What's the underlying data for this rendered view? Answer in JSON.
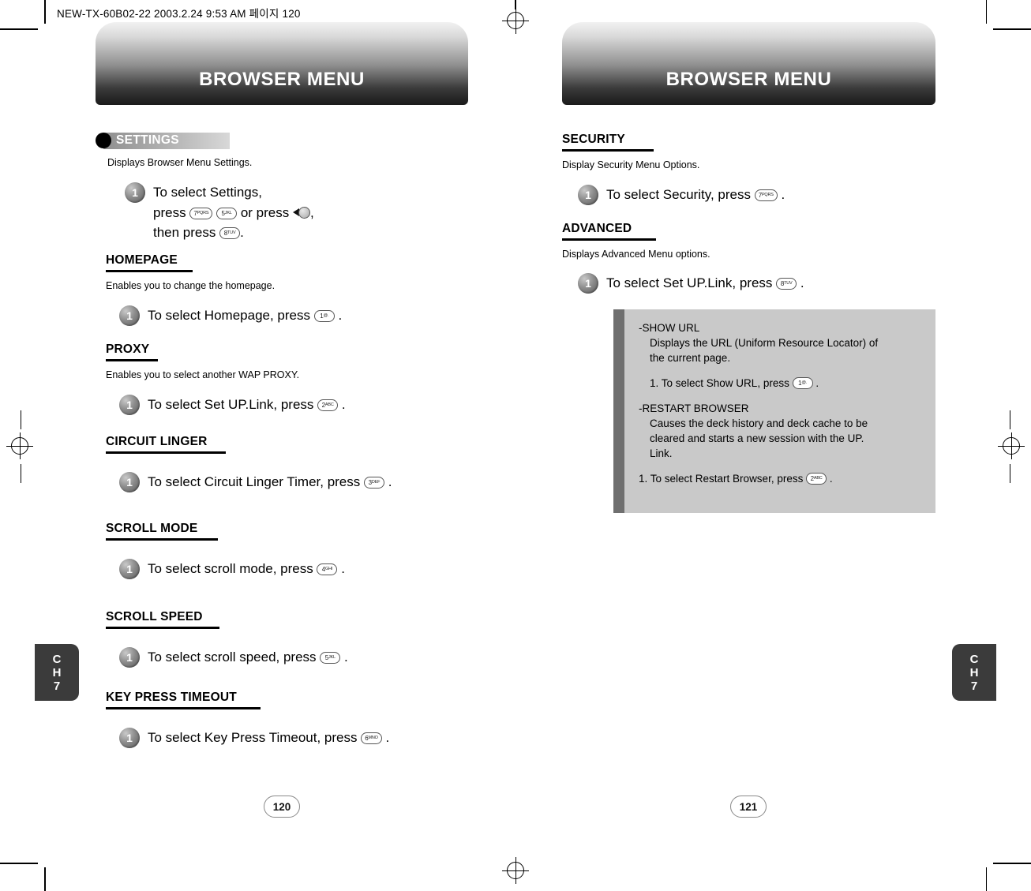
{
  "print_header": "NEW-TX-60B02-22  2003.2.24 9:53 AM  페이지 120",
  "left_page": {
    "title": "BROWSER MENU",
    "settings_pill": "SETTINGS",
    "settings_desc": "Displays Browser Menu Settings.",
    "settings_step": {
      "num": "1",
      "line1": "To select Settings,",
      "line2_pre": "press",
      "line2_key1": "7",
      "line2_key1_sup": "PQRS",
      "line2_key2": "5",
      "line2_key2_sup": "JKL",
      "line2_mid": "or press",
      "line2_post": ",",
      "line3_pre": "then press",
      "line3_key": "8",
      "line3_key_sup": "TUV",
      "line3_post": "."
    },
    "sections": [
      {
        "head": "HOMEPAGE",
        "desc": "Enables you to change the homepage.",
        "step_num": "1",
        "step_pre": "To select Homepage, press",
        "key": "1",
        "key_sup": "@.",
        "step_post": "."
      },
      {
        "head": "PROXY",
        "desc": "Enables you to select another WAP PROXY.",
        "step_num": "1",
        "step_pre": "To select Set UP.Link, press",
        "key": "2",
        "key_sup": "ABC",
        "step_post": "."
      },
      {
        "head": "CIRCUIT LINGER",
        "desc": "",
        "step_num": "1",
        "step_pre": "To select Circuit Linger Timer, press",
        "key": "3",
        "key_sup": "DEF",
        "step_post": "."
      },
      {
        "head": "SCROLL MODE",
        "desc": "",
        "step_num": "1",
        "step_pre": "To select scroll mode, press",
        "key": "4",
        "key_sup": "GHI",
        "step_post": "."
      },
      {
        "head": "SCROLL SPEED",
        "desc": "",
        "step_num": "1",
        "step_pre": "To select scroll speed, press",
        "key": "5",
        "key_sup": "JKL",
        "step_post": "."
      },
      {
        "head": "KEY PRESS TIMEOUT",
        "desc": "",
        "step_num": "1",
        "step_pre": "To select Key Press Timeout, press",
        "key": "6",
        "key_sup": "MNO",
        "step_post": "."
      }
    ],
    "chapter": {
      "line1": "C",
      "line2": "H",
      "line3": "7"
    },
    "page_number": "120"
  },
  "right_page": {
    "title": "BROWSER MENU",
    "sections": [
      {
        "head": "SECURITY",
        "desc": "Display Security Menu Options.",
        "step_num": "1",
        "step_pre": "To select Security, press",
        "key": "7",
        "key_sup": "PQRS",
        "step_post": "."
      },
      {
        "head": "ADVANCED",
        "desc": "Displays Advanced Menu options.",
        "step_num": "1",
        "step_pre": "To select Set UP.Link, press",
        "key": "8",
        "key_sup": "TUV",
        "step_post": "."
      }
    ],
    "notebox": {
      "item1_title": "-SHOW URL",
      "item1_body_l1": "Displays the URL (Uniform Resource Locator) of",
      "item1_body_l2": "the current page.",
      "item1_step_pre": "1. To select Show URL, press",
      "item1_key": "1",
      "item1_key_sup": "@.",
      "item1_step_post": ".",
      "item2_title": "-RESTART BROWSER",
      "item2_body_l1": "Causes the deck history and deck cache to be",
      "item2_body_l2": "cleared and starts a new session with the UP.",
      "item2_body_l3": "Link.",
      "item2_step_pre": "1. To select Restart Browser, press",
      "item2_key": "2",
      "item2_key_sup": "ABC",
      "item2_step_post": "."
    },
    "chapter": {
      "line1": "C",
      "line2": "H",
      "line3": "7"
    },
    "page_number": "121"
  }
}
